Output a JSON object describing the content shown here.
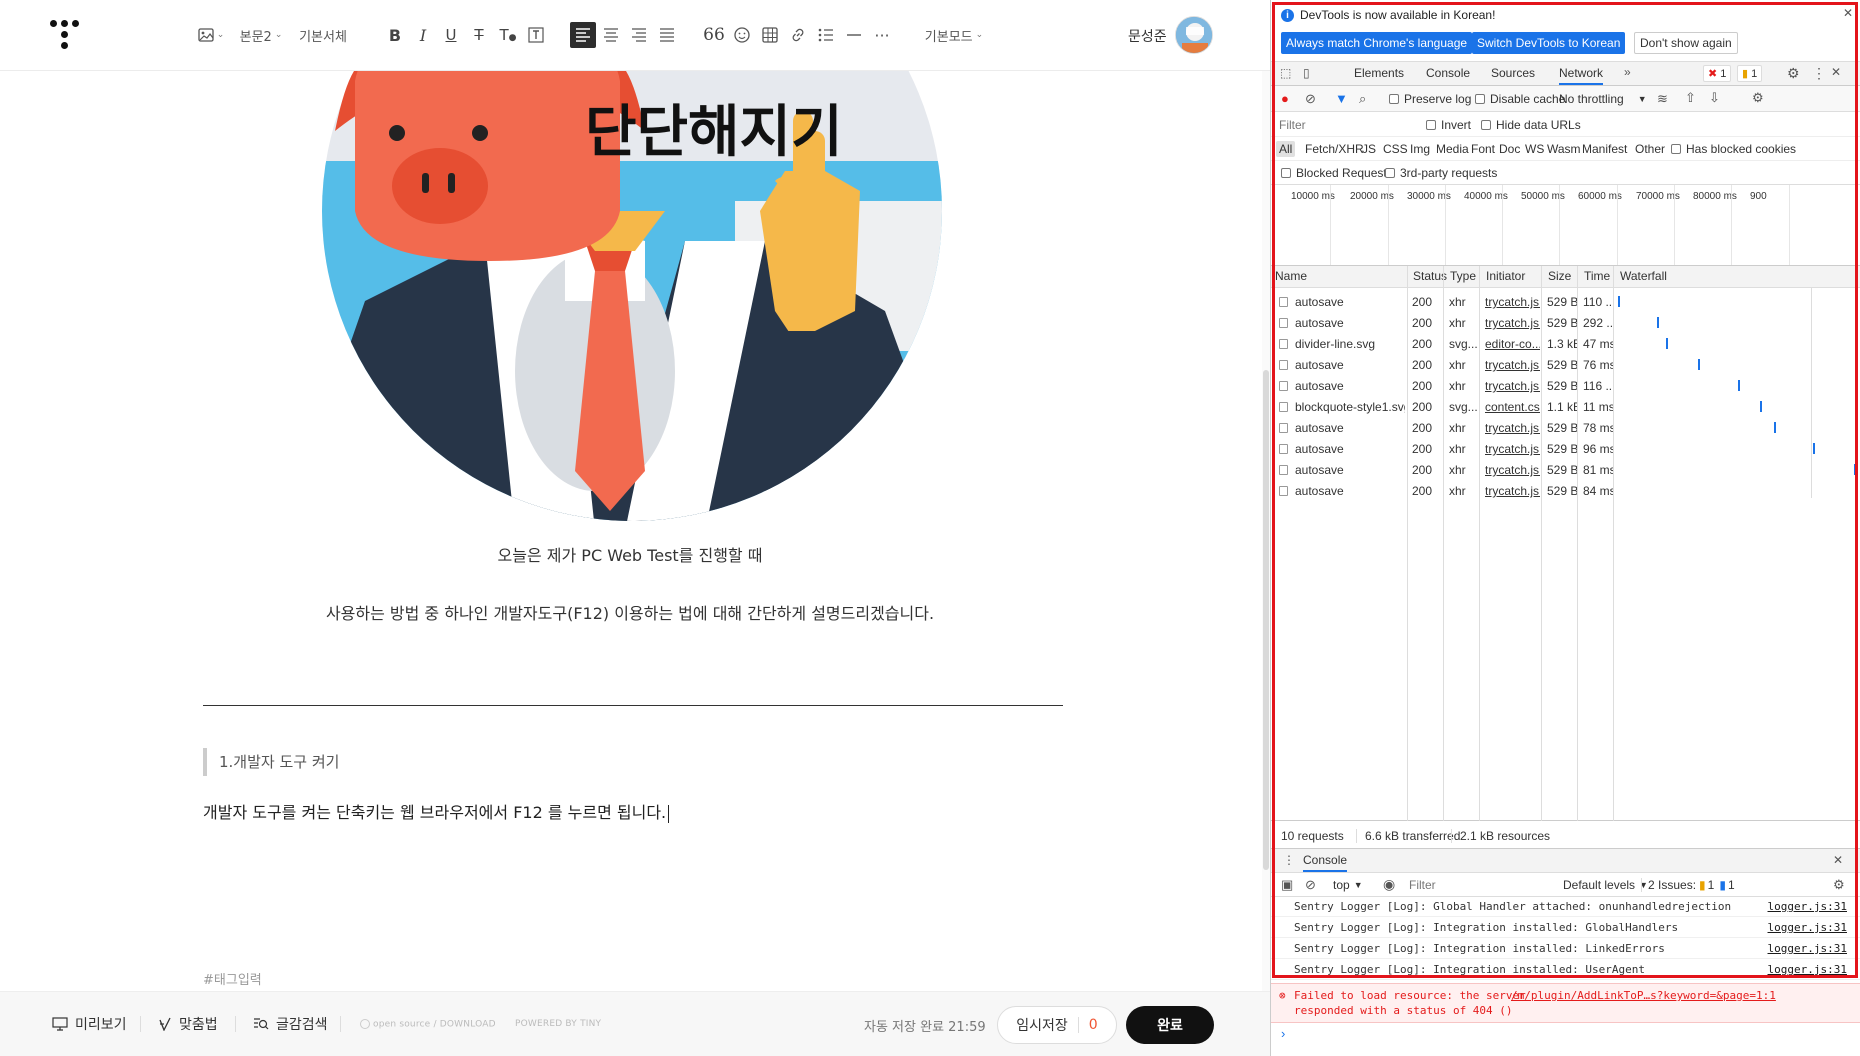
{
  "editor": {
    "toolbar": {
      "style_label": "본문2",
      "font_label": "기본서체",
      "mode_label": "기본모드",
      "user_name": "문성준"
    },
    "illustration": {
      "title_text": "단단해지기"
    },
    "content": {
      "line1": "오늘은 제가 PC Web Test를 진행할 때",
      "line2": "사용하는 방법 중 하나인 개발자도구(F12) 이용하는 법에 대해 간단하게 설명드리겠습니다.",
      "quote": "1.개발자 도구 켜기",
      "body": "개발자 도구를 켜는 단축키는 웹 브라우저에서 F12 를 누르면 됩니다.",
      "tag_placeholder": "#태그입력"
    },
    "footer": {
      "preview": "미리보기",
      "spellcheck": "맞춤법",
      "search": "글감검색",
      "opensource": "open source / DOWNLOAD",
      "powered": "POWERED BY TINY",
      "autosave": "자동 저장 완료 21:59",
      "temp_save": "임시저장",
      "temp_count": "0",
      "done": "완료"
    }
  },
  "devtools": {
    "info": {
      "message": "DevTools is now available in Korean!",
      "btn_match": "Always match Chrome's language",
      "btn_switch": "Switch DevTools to Korean",
      "btn_dismiss": "Don't show again"
    },
    "tabs": [
      "Elements",
      "Console",
      "Sources",
      "Network"
    ],
    "active_tab": "Network",
    "badges": {
      "errors": "1",
      "warnings": "1"
    },
    "network_toolbar": {
      "preserve_log": "Preserve log",
      "disable_cache": "Disable cache",
      "throttling": "No throttling"
    },
    "filter": {
      "placeholder": "Filter",
      "invert": "Invert",
      "hide_data_urls": "Hide data URLs"
    },
    "types": [
      "All",
      "Fetch/XHR",
      "JS",
      "CSS",
      "Img",
      "Media",
      "Font",
      "Doc",
      "WS",
      "Wasm",
      "Manifest",
      "Other"
    ],
    "has_blocked_cookies": "Has blocked cookies",
    "blocked_requests": "Blocked Requests",
    "third_party": "3rd-party requests",
    "timeline_ticks": [
      "10000 ms",
      "20000 ms",
      "30000 ms",
      "40000 ms",
      "50000 ms",
      "60000 ms",
      "70000 ms",
      "80000 ms",
      "900"
    ],
    "columns": [
      "Name",
      "Status",
      "Type",
      "Initiator",
      "Size",
      "Time",
      "Waterfall"
    ],
    "requests": [
      {
        "name": "autosave",
        "status": "200",
        "type": "xhr",
        "initiator": "trycatch.js...",
        "size": "529 B",
        "time": "110 ...",
        "wf": 0.01
      },
      {
        "name": "autosave",
        "status": "200",
        "type": "xhr",
        "initiator": "trycatch.js...",
        "size": "529 B",
        "time": "292 ...",
        "wf": 0.17
      },
      {
        "name": "divider-line.svg",
        "status": "200",
        "type": "svg...",
        "initiator": "editor-co...",
        "size": "1.3 kB",
        "time": "47 ms",
        "wf": 0.21
      },
      {
        "name": "autosave",
        "status": "200",
        "type": "xhr",
        "initiator": "trycatch.js...",
        "size": "529 B",
        "time": "76 ms",
        "wf": 0.34
      },
      {
        "name": "autosave",
        "status": "200",
        "type": "xhr",
        "initiator": "trycatch.js...",
        "size": "529 B",
        "time": "116 ...",
        "wf": 0.51
      },
      {
        "name": "blockquote-style1.svg",
        "status": "200",
        "type": "svg...",
        "initiator": "content.css",
        "size": "1.1 kB",
        "time": "11 ms",
        "wf": 0.6
      },
      {
        "name": "autosave",
        "status": "200",
        "type": "xhr",
        "initiator": "trycatch.js...",
        "size": "529 B",
        "time": "78 ms",
        "wf": 0.66
      },
      {
        "name": "autosave",
        "status": "200",
        "type": "xhr",
        "initiator": "trycatch.js...",
        "size": "529 B",
        "time": "96 ms",
        "wf": 0.82
      },
      {
        "name": "autosave",
        "status": "200",
        "type": "xhr",
        "initiator": "trycatch.js...",
        "size": "529 B",
        "time": "81 ms",
        "wf": 0.99
      },
      {
        "name": "autosave",
        "status": "200",
        "type": "xhr",
        "initiator": "trycatch.js...",
        "size": "529 B",
        "time": "84 ms",
        "wf": null
      }
    ],
    "summary": {
      "requests": "10 requests",
      "transferred": "6.6 kB transferred",
      "resources": "2.1 kB resources"
    },
    "console": {
      "title": "Console",
      "context": "top",
      "filter_placeholder": "Filter",
      "levels": "Default levels",
      "issues_label": "2 Issues:",
      "issues_warn": "1",
      "issues_info": "1",
      "logs": [
        {
          "text": "Sentry Logger [Log]: Global Handler attached: onunhandledrejection",
          "src": "logger.js:31"
        },
        {
          "text": "Sentry Logger [Log]: Integration installed: GlobalHandlers",
          "src": "logger.js:31"
        },
        {
          "text": "Sentry Logger [Log]: Integration installed: LinkedErrors",
          "src": "logger.js:31"
        },
        {
          "text": "Sentry Logger [Log]: Integration installed: UserAgent",
          "src": "logger.js:31"
        }
      ],
      "error_line1": "Failed to load resource: the server",
      "error_line2": "responded with a status of 404 ()",
      "error_src": "/m/plugin/AddLinkToP…s?keyword=&page=1:1"
    }
  }
}
